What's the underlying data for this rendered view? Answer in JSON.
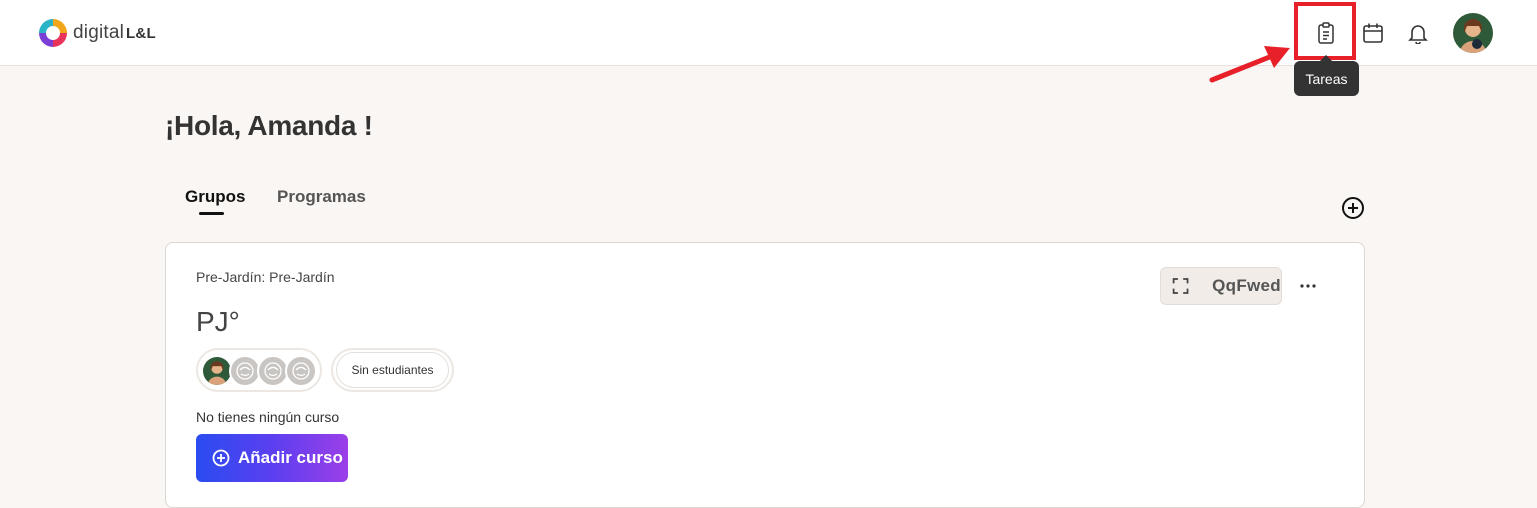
{
  "header": {
    "logo_text": "digital",
    "logo_suffix": "L&L",
    "tasks_tooltip": "Tareas",
    "icons": [
      "clipboard-icon",
      "calendar-icon",
      "bell-icon"
    ]
  },
  "greeting": "¡Hola, Amanda !",
  "tabs": [
    {
      "label": "Grupos",
      "active": true
    },
    {
      "label": "Programas",
      "active": false
    }
  ],
  "group_card": {
    "subtitle": "Pre-Jardín: Pre-Jardín",
    "title": "PJ°",
    "code": "QqFwed",
    "students_label": "Sin estudiantes",
    "no_course_text": "No tienes ningún curso",
    "add_course_label": "Añadir curso"
  },
  "colors": {
    "accent_start": "#2a4cf0",
    "accent_end": "#9b3fe8",
    "highlight": "#e8202a",
    "page_bg": "#f9f6f3"
  }
}
